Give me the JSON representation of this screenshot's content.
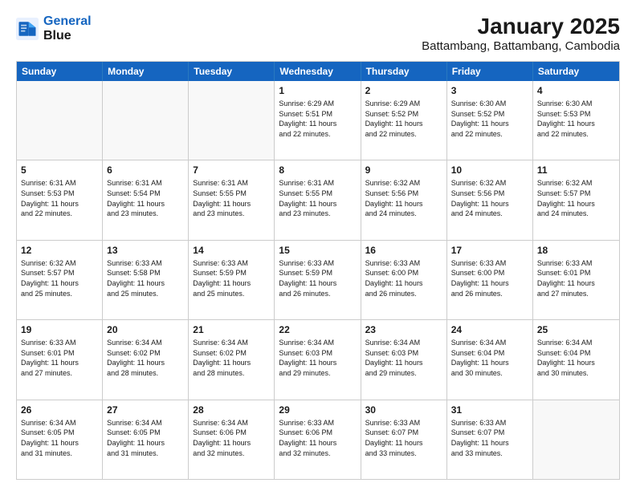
{
  "header": {
    "logo_line1": "General",
    "logo_line2": "Blue",
    "title": "January 2025",
    "subtitle": "Battambang, Battambang, Cambodia"
  },
  "weekdays": [
    "Sunday",
    "Monday",
    "Tuesday",
    "Wednesday",
    "Thursday",
    "Friday",
    "Saturday"
  ],
  "weeks": [
    [
      {
        "day": "",
        "info": "",
        "empty": true
      },
      {
        "day": "",
        "info": "",
        "empty": true
      },
      {
        "day": "",
        "info": "",
        "empty": true
      },
      {
        "day": "1",
        "info": "Sunrise: 6:29 AM\nSunset: 5:51 PM\nDaylight: 11 hours\nand 22 minutes.",
        "empty": false
      },
      {
        "day": "2",
        "info": "Sunrise: 6:29 AM\nSunset: 5:52 PM\nDaylight: 11 hours\nand 22 minutes.",
        "empty": false
      },
      {
        "day": "3",
        "info": "Sunrise: 6:30 AM\nSunset: 5:52 PM\nDaylight: 11 hours\nand 22 minutes.",
        "empty": false
      },
      {
        "day": "4",
        "info": "Sunrise: 6:30 AM\nSunset: 5:53 PM\nDaylight: 11 hours\nand 22 minutes.",
        "empty": false
      }
    ],
    [
      {
        "day": "5",
        "info": "Sunrise: 6:31 AM\nSunset: 5:53 PM\nDaylight: 11 hours\nand 22 minutes.",
        "empty": false
      },
      {
        "day": "6",
        "info": "Sunrise: 6:31 AM\nSunset: 5:54 PM\nDaylight: 11 hours\nand 23 minutes.",
        "empty": false
      },
      {
        "day": "7",
        "info": "Sunrise: 6:31 AM\nSunset: 5:55 PM\nDaylight: 11 hours\nand 23 minutes.",
        "empty": false
      },
      {
        "day": "8",
        "info": "Sunrise: 6:31 AM\nSunset: 5:55 PM\nDaylight: 11 hours\nand 23 minutes.",
        "empty": false
      },
      {
        "day": "9",
        "info": "Sunrise: 6:32 AM\nSunset: 5:56 PM\nDaylight: 11 hours\nand 24 minutes.",
        "empty": false
      },
      {
        "day": "10",
        "info": "Sunrise: 6:32 AM\nSunset: 5:56 PM\nDaylight: 11 hours\nand 24 minutes.",
        "empty": false
      },
      {
        "day": "11",
        "info": "Sunrise: 6:32 AM\nSunset: 5:57 PM\nDaylight: 11 hours\nand 24 minutes.",
        "empty": false
      }
    ],
    [
      {
        "day": "12",
        "info": "Sunrise: 6:32 AM\nSunset: 5:57 PM\nDaylight: 11 hours\nand 25 minutes.",
        "empty": false
      },
      {
        "day": "13",
        "info": "Sunrise: 6:33 AM\nSunset: 5:58 PM\nDaylight: 11 hours\nand 25 minutes.",
        "empty": false
      },
      {
        "day": "14",
        "info": "Sunrise: 6:33 AM\nSunset: 5:59 PM\nDaylight: 11 hours\nand 25 minutes.",
        "empty": false
      },
      {
        "day": "15",
        "info": "Sunrise: 6:33 AM\nSunset: 5:59 PM\nDaylight: 11 hours\nand 26 minutes.",
        "empty": false
      },
      {
        "day": "16",
        "info": "Sunrise: 6:33 AM\nSunset: 6:00 PM\nDaylight: 11 hours\nand 26 minutes.",
        "empty": false
      },
      {
        "day": "17",
        "info": "Sunrise: 6:33 AM\nSunset: 6:00 PM\nDaylight: 11 hours\nand 26 minutes.",
        "empty": false
      },
      {
        "day": "18",
        "info": "Sunrise: 6:33 AM\nSunset: 6:01 PM\nDaylight: 11 hours\nand 27 minutes.",
        "empty": false
      }
    ],
    [
      {
        "day": "19",
        "info": "Sunrise: 6:33 AM\nSunset: 6:01 PM\nDaylight: 11 hours\nand 27 minutes.",
        "empty": false
      },
      {
        "day": "20",
        "info": "Sunrise: 6:34 AM\nSunset: 6:02 PM\nDaylight: 11 hours\nand 28 minutes.",
        "empty": false
      },
      {
        "day": "21",
        "info": "Sunrise: 6:34 AM\nSunset: 6:02 PM\nDaylight: 11 hours\nand 28 minutes.",
        "empty": false
      },
      {
        "day": "22",
        "info": "Sunrise: 6:34 AM\nSunset: 6:03 PM\nDaylight: 11 hours\nand 29 minutes.",
        "empty": false
      },
      {
        "day": "23",
        "info": "Sunrise: 6:34 AM\nSunset: 6:03 PM\nDaylight: 11 hours\nand 29 minutes.",
        "empty": false
      },
      {
        "day": "24",
        "info": "Sunrise: 6:34 AM\nSunset: 6:04 PM\nDaylight: 11 hours\nand 30 minutes.",
        "empty": false
      },
      {
        "day": "25",
        "info": "Sunrise: 6:34 AM\nSunset: 6:04 PM\nDaylight: 11 hours\nand 30 minutes.",
        "empty": false
      }
    ],
    [
      {
        "day": "26",
        "info": "Sunrise: 6:34 AM\nSunset: 6:05 PM\nDaylight: 11 hours\nand 31 minutes.",
        "empty": false
      },
      {
        "day": "27",
        "info": "Sunrise: 6:34 AM\nSunset: 6:05 PM\nDaylight: 11 hours\nand 31 minutes.",
        "empty": false
      },
      {
        "day": "28",
        "info": "Sunrise: 6:34 AM\nSunset: 6:06 PM\nDaylight: 11 hours\nand 32 minutes.",
        "empty": false
      },
      {
        "day": "29",
        "info": "Sunrise: 6:33 AM\nSunset: 6:06 PM\nDaylight: 11 hours\nand 32 minutes.",
        "empty": false
      },
      {
        "day": "30",
        "info": "Sunrise: 6:33 AM\nSunset: 6:07 PM\nDaylight: 11 hours\nand 33 minutes.",
        "empty": false
      },
      {
        "day": "31",
        "info": "Sunrise: 6:33 AM\nSunset: 6:07 PM\nDaylight: 11 hours\nand 33 minutes.",
        "empty": false
      },
      {
        "day": "",
        "info": "",
        "empty": true
      }
    ]
  ]
}
